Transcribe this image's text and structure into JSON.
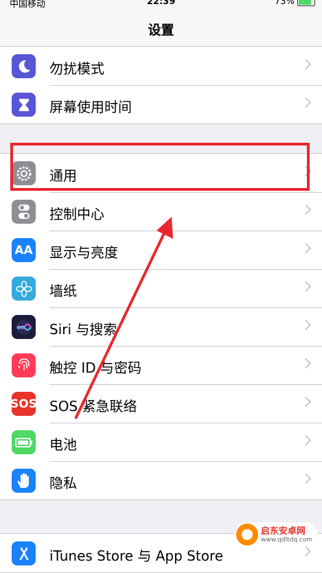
{
  "status_bar": {
    "carrier": "中国移动",
    "time": "22:39",
    "battery": "73%"
  },
  "nav": {
    "title": "设置"
  },
  "group1": [
    {
      "label": "勿扰模式",
      "icon": "moon-icon",
      "color": "#5856d6"
    },
    {
      "label": "屏幕使用时间",
      "icon": "hourglass-icon",
      "color": "#5856d6"
    }
  ],
  "group2": [
    {
      "label": "通用",
      "icon": "gear-icon",
      "color": "#8e8e93"
    },
    {
      "label": "控制中心",
      "icon": "toggle-icon",
      "color": "#8e8e93"
    },
    {
      "label": "显示与亮度",
      "icon": "text-size-icon",
      "color": "#1a82fb",
      "glyph": "AA"
    },
    {
      "label": "墙纸",
      "icon": "flower-icon",
      "color": "#34aadc"
    },
    {
      "label": "Siri 与搜索",
      "icon": "siri-icon",
      "color": "#1c1c3a"
    },
    {
      "label": "触控 ID 与密码",
      "icon": "fingerprint-icon",
      "color": "#ff3b57"
    },
    {
      "label": "SOS 紧急联络",
      "icon": "sos-icon",
      "color": "#e8322a",
      "glyph": "SOS"
    },
    {
      "label": "电池",
      "icon": "battery-icon",
      "color": "#4cd964"
    },
    {
      "label": "隐私",
      "icon": "hand-icon",
      "color": "#1a82fb"
    }
  ],
  "group3": [
    {
      "label": "iTunes Store 与 App Store",
      "icon": "app-store-icon",
      "color": "#1a82fb"
    }
  ],
  "watermark": {
    "name": "启东安卓网",
    "url": "www.qdltdq.com"
  }
}
